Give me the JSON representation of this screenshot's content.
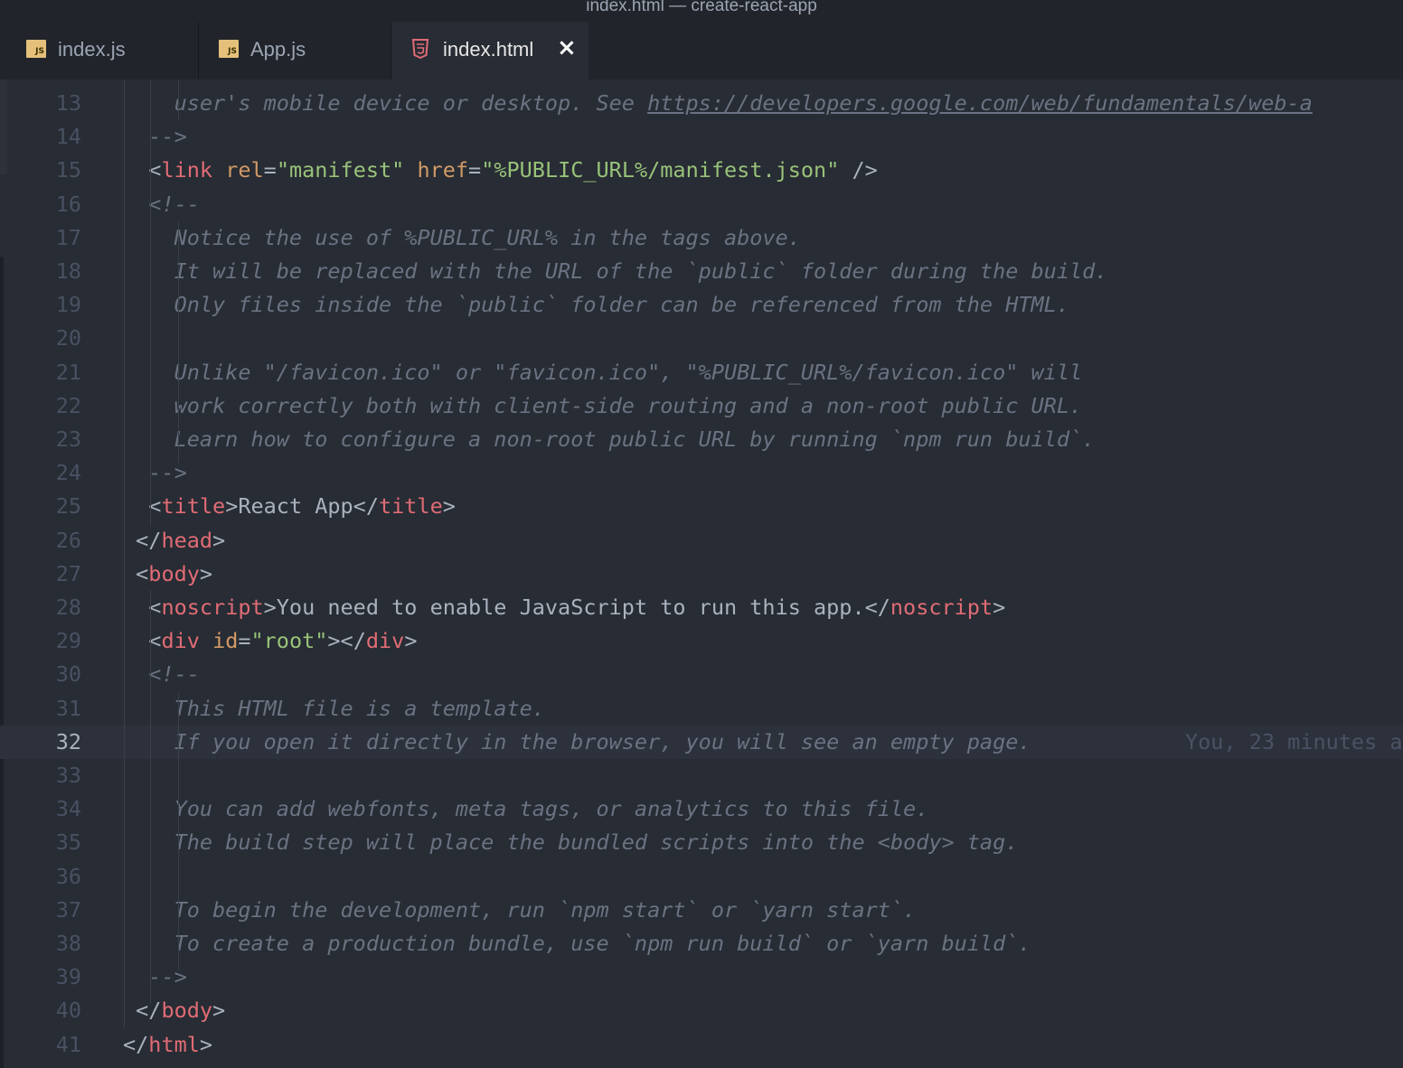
{
  "window": {
    "title": "index.html — create-react-app"
  },
  "tabs": [
    {
      "label": "index.js",
      "icon": "js-file-icon",
      "active": false
    },
    {
      "label": "App.js",
      "icon": "js-file-icon",
      "active": false
    },
    {
      "label": "index.html",
      "icon": "html5-file-icon",
      "active": true,
      "close_glyph": "×"
    }
  ],
  "js_badge_text": "JS",
  "editor": {
    "cursor_line": 32,
    "blame_text": "You, 23 minutes a",
    "lines": [
      {
        "n": "13",
        "segments": [
          {
            "t": "    ",
            "c": "punc"
          },
          {
            "t": "user's mobile device or desktop. See ",
            "c": "cmt"
          },
          {
            "t": "https://developers.google.com/web/fundamentals/web-a",
            "c": "cmt-url"
          }
        ]
      },
      {
        "n": "14",
        "segments": [
          {
            "t": "  ",
            "c": "punc"
          },
          {
            "t": "-->",
            "c": "cmt"
          }
        ]
      },
      {
        "n": "15",
        "segments": [
          {
            "t": "  <",
            "c": "punc"
          },
          {
            "t": "link",
            "c": "tag"
          },
          {
            "t": " ",
            "c": "punc"
          },
          {
            "t": "rel",
            "c": "attr"
          },
          {
            "t": "=",
            "c": "punc"
          },
          {
            "t": "\"manifest\"",
            "c": "str"
          },
          {
            "t": " ",
            "c": "punc"
          },
          {
            "t": "href",
            "c": "attr"
          },
          {
            "t": "=",
            "c": "punc"
          },
          {
            "t": "\"%PUBLIC_URL%/manifest.json\"",
            "c": "str"
          },
          {
            "t": " />",
            "c": "punc"
          }
        ]
      },
      {
        "n": "16",
        "segments": [
          {
            "t": "  ",
            "c": "punc"
          },
          {
            "t": "<!--",
            "c": "cmt"
          }
        ]
      },
      {
        "n": "17",
        "segments": [
          {
            "t": "    ",
            "c": "punc"
          },
          {
            "t": "Notice the use of %PUBLIC_URL% in the tags above.",
            "c": "cmt"
          }
        ]
      },
      {
        "n": "18",
        "segments": [
          {
            "t": "    ",
            "c": "punc"
          },
          {
            "t": "It will be replaced with the URL of the `public` folder during the build.",
            "c": "cmt"
          }
        ]
      },
      {
        "n": "19",
        "segments": [
          {
            "t": "    ",
            "c": "punc"
          },
          {
            "t": "Only files inside the `public` folder can be referenced from the HTML.",
            "c": "cmt"
          }
        ]
      },
      {
        "n": "20",
        "segments": []
      },
      {
        "n": "21",
        "segments": [
          {
            "t": "    ",
            "c": "punc"
          },
          {
            "t": "Unlike \"/favicon.ico\" or \"favicon.ico\", \"%PUBLIC_URL%/favicon.ico\" will",
            "c": "cmt"
          }
        ]
      },
      {
        "n": "22",
        "segments": [
          {
            "t": "    ",
            "c": "punc"
          },
          {
            "t": "work correctly both with client-side routing and a non-root public URL.",
            "c": "cmt"
          }
        ]
      },
      {
        "n": "23",
        "segments": [
          {
            "t": "    ",
            "c": "punc"
          },
          {
            "t": "Learn how to configure a non-root public URL by running `npm run build`.",
            "c": "cmt"
          }
        ]
      },
      {
        "n": "24",
        "segments": [
          {
            "t": "  ",
            "c": "punc"
          },
          {
            "t": "-->",
            "c": "cmt"
          }
        ]
      },
      {
        "n": "25",
        "segments": [
          {
            "t": "  <",
            "c": "punc"
          },
          {
            "t": "title",
            "c": "tag"
          },
          {
            "t": ">React App</",
            "c": "punc"
          },
          {
            "t": "title",
            "c": "tag"
          },
          {
            "t": ">",
            "c": "punc"
          }
        ]
      },
      {
        "n": "26",
        "segments": [
          {
            "t": " </",
            "c": "punc"
          },
          {
            "t": "head",
            "c": "tag"
          },
          {
            "t": ">",
            "c": "punc"
          }
        ]
      },
      {
        "n": "27",
        "segments": [
          {
            "t": " <",
            "c": "punc"
          },
          {
            "t": "body",
            "c": "tag"
          },
          {
            "t": ">",
            "c": "punc"
          }
        ]
      },
      {
        "n": "28",
        "segments": [
          {
            "t": "  <",
            "c": "punc"
          },
          {
            "t": "noscript",
            "c": "tag"
          },
          {
            "t": ">You need to enable JavaScript to run this app.</",
            "c": "punc"
          },
          {
            "t": "noscript",
            "c": "tag"
          },
          {
            "t": ">",
            "c": "punc"
          }
        ]
      },
      {
        "n": "29",
        "segments": [
          {
            "t": "  <",
            "c": "punc"
          },
          {
            "t": "div",
            "c": "tag"
          },
          {
            "t": " ",
            "c": "punc"
          },
          {
            "t": "id",
            "c": "attr"
          },
          {
            "t": "=",
            "c": "punc"
          },
          {
            "t": "\"root\"",
            "c": "str"
          },
          {
            "t": "></",
            "c": "punc"
          },
          {
            "t": "div",
            "c": "tag"
          },
          {
            "t": ">",
            "c": "punc"
          }
        ]
      },
      {
        "n": "30",
        "segments": [
          {
            "t": "  ",
            "c": "punc"
          },
          {
            "t": "<!--",
            "c": "cmt"
          }
        ]
      },
      {
        "n": "31",
        "segments": [
          {
            "t": "    ",
            "c": "punc"
          },
          {
            "t": "This HTML file is a template.",
            "c": "cmt"
          }
        ]
      },
      {
        "n": "32",
        "segments": [
          {
            "t": "    ",
            "c": "punc"
          },
          {
            "t": "If you open it directly in the browser, you will see an empty page.",
            "c": "cmt"
          }
        ]
      },
      {
        "n": "33",
        "segments": []
      },
      {
        "n": "34",
        "segments": [
          {
            "t": "    ",
            "c": "punc"
          },
          {
            "t": "You can add webfonts, meta tags, or analytics to this file.",
            "c": "cmt"
          }
        ]
      },
      {
        "n": "35",
        "segments": [
          {
            "t": "    ",
            "c": "punc"
          },
          {
            "t": "The build step will place the bundled scripts into the <body> tag.",
            "c": "cmt"
          }
        ]
      },
      {
        "n": "36",
        "segments": []
      },
      {
        "n": "37",
        "segments": [
          {
            "t": "    ",
            "c": "punc"
          },
          {
            "t": "To begin the development, run `npm start` or `yarn start`.",
            "c": "cmt"
          }
        ]
      },
      {
        "n": "38",
        "segments": [
          {
            "t": "    ",
            "c": "punc"
          },
          {
            "t": "To create a production bundle, use `npm run build` or `yarn build`.",
            "c": "cmt"
          }
        ]
      },
      {
        "n": "39",
        "segments": [
          {
            "t": "  ",
            "c": "punc"
          },
          {
            "t": "-->",
            "c": "cmt"
          }
        ]
      },
      {
        "n": "40",
        "segments": [
          {
            "t": " </",
            "c": "punc"
          },
          {
            "t": "body",
            "c": "tag"
          },
          {
            "t": ">",
            "c": "punc"
          }
        ]
      },
      {
        "n": "41",
        "segments": [
          {
            "t": "</",
            "c": "punc"
          },
          {
            "t": "html",
            "c": "tag"
          },
          {
            "t": ">",
            "c": "punc"
          }
        ]
      }
    ]
  }
}
